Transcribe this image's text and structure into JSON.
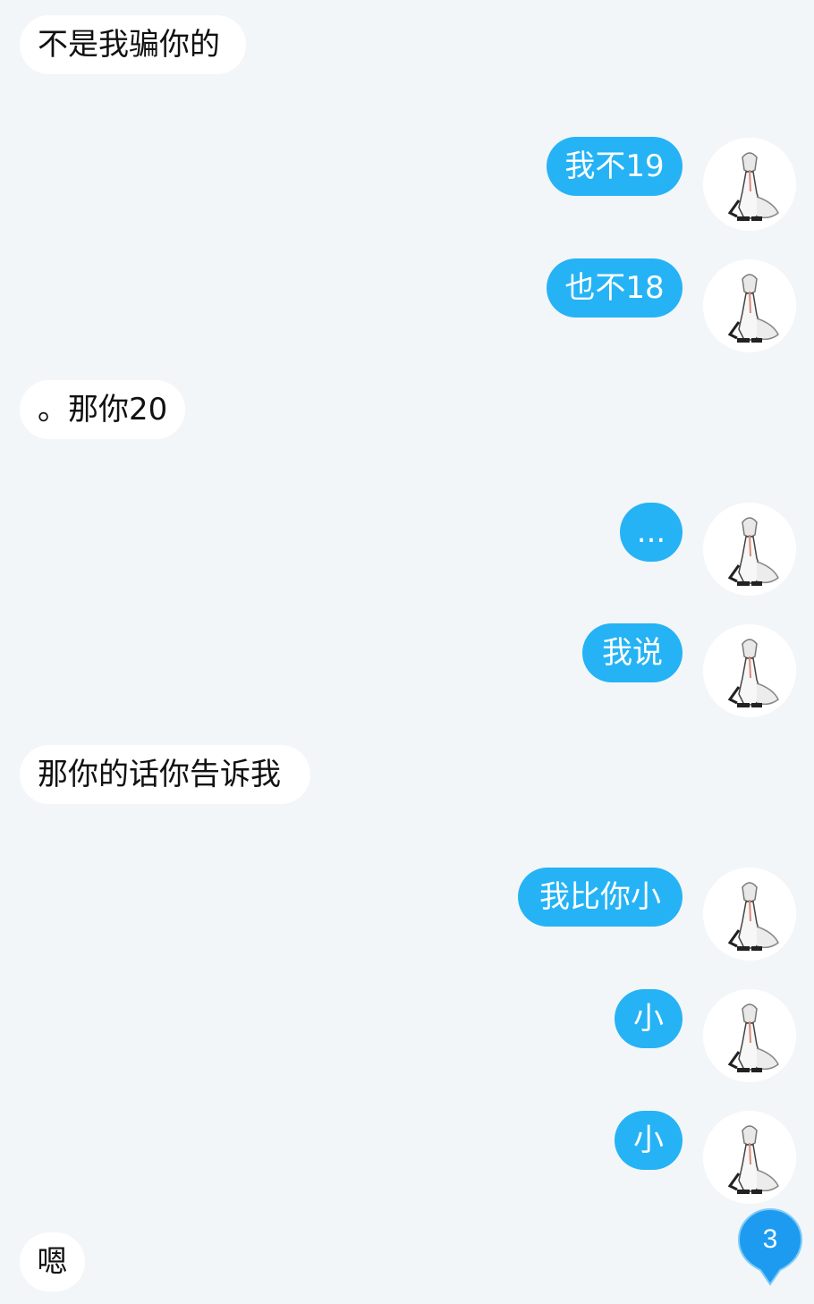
{
  "messages": [
    {
      "side": "in",
      "text": "不是我骗你的"
    },
    {
      "side": "out",
      "text": "我不19"
    },
    {
      "side": "out",
      "text": "也不18"
    },
    {
      "side": "in",
      "text": "。那你20"
    },
    {
      "side": "out",
      "text": "..."
    },
    {
      "side": "out",
      "text": "我说"
    },
    {
      "side": "in",
      "text": "那你的话你告诉我"
    },
    {
      "side": "out",
      "text": "我比你小"
    },
    {
      "side": "out",
      "text": "小"
    },
    {
      "side": "out",
      "text": "小"
    },
    {
      "side": "in",
      "text": "嗯"
    }
  ],
  "unread_badge": {
    "count": "3"
  },
  "colors": {
    "background": "#f2f6f9",
    "outgoing_bubble": "#25b3f5",
    "incoming_bubble": "#ffffff",
    "badge": "#1d9bf0"
  },
  "avatar": {
    "icon": "anime-character-avatar-icon"
  }
}
